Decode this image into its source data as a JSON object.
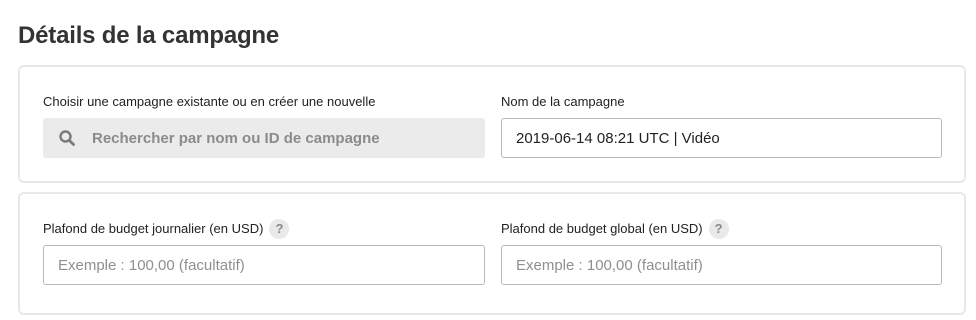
{
  "page": {
    "title": "Détails de la campagne"
  },
  "campaign_select": {
    "label": "Choisir une campagne existante ou en créer une nouvelle",
    "search_placeholder": "Rechercher par nom ou ID de campagne",
    "search_icon": "search-icon"
  },
  "campaign_name": {
    "label": "Nom de la campagne",
    "value": "2019-06-14 08:21 UTC | Vidéo"
  },
  "daily_budget": {
    "label": "Plafond de budget journalier (en USD)",
    "help_glyph": "?",
    "placeholder": "Exemple : 100,00 (facultatif)",
    "value": ""
  },
  "total_budget": {
    "label": "Plafond de budget global (en USD)",
    "help_glyph": "?",
    "placeholder": "Exemple : 100,00 (facultatif)",
    "value": ""
  }
}
